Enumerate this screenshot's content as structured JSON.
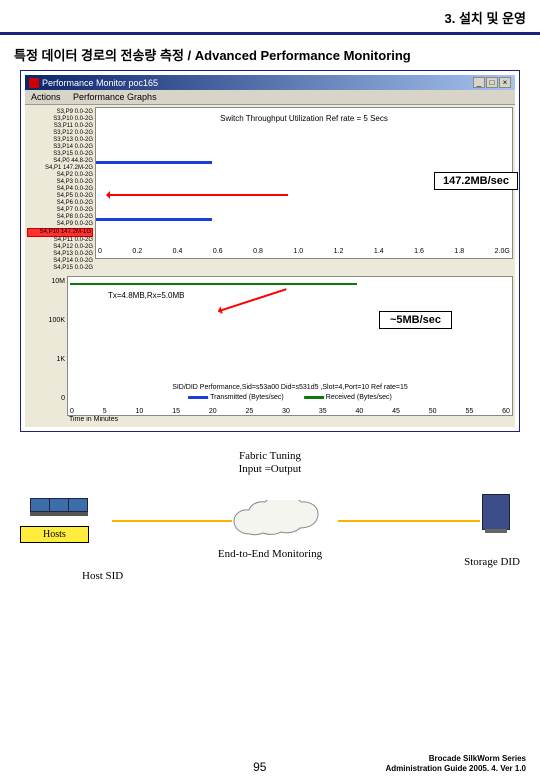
{
  "header": {
    "chapter": "3. 설치 및 운영"
  },
  "section_title": "특정 데이터 경로의 전송량 측정 / Advanced Performance Monitoring",
  "window": {
    "title": "Performance Monitor poc165",
    "menu": [
      "Actions",
      "Performance Graphs"
    ],
    "controls": [
      "_",
      "□",
      "×"
    ]
  },
  "chart_data": [
    {
      "type": "bar",
      "title": "Switch Throughput Utilization Ref rate = 5 Secs",
      "y_ports": [
        "S3,P9  0.0-2G",
        "S3,P10 0.0-2G",
        "S3,P11 0.0-2G",
        "S3,P12 0.0-2G",
        "S3,P13 0.0-2G",
        "S3,P14 0.0-2G",
        "S3,P15 0.0-2G",
        "S4,P0  44.8-2G",
        "S4,P1  147.2M-2G",
        "S4,P2  0.0-2G",
        "S4,P3  0.0-2G",
        "S4,P4  0.0-2G",
        "S4,P5  0.0-2G",
        "S4,P6  0.0-2G",
        "S4,P7  0.0-2G",
        "S4,P8  0.0-2G",
        "S4,P9  0.0-2G",
        "S4,P10 147.2M-1G",
        "S4,P11 0.0-2G",
        "S4,P12 0.0-2G",
        "S4,P13 0.0-2G",
        "S4,P14 0.0-2G",
        "S4,P15 0.0-2G"
      ],
      "highlight_port_index": 17,
      "blue_bars": [
        {
          "port_index": 8,
          "frac": 0.28
        },
        {
          "port_index": 17,
          "frac": 0.28
        }
      ],
      "x_ticks": [
        "0",
        "0.2",
        "0.4",
        "0.6",
        "0.8",
        "1.0",
        "1.2",
        "1.4",
        "1.6",
        "1.8",
        "2.0G"
      ],
      "callout": "147.2MB/sec"
    },
    {
      "type": "line",
      "title_below": "SID/DID Performance,Sid=s53a00  Did=s531d5 ,Slot=4,Port=10 Ref rate=15",
      "y_ticks": [
        "10M",
        "100K",
        "1K",
        "0"
      ],
      "x_ticks": [
        "0",
        "5",
        "10",
        "15",
        "20",
        "25",
        "30",
        "35",
        "40",
        "45",
        "50",
        "55",
        "60"
      ],
      "x_label": "Time in Minutes",
      "series": [
        {
          "name": "Transmitted (Bytes/sec)",
          "color": "#1a3de0"
        },
        {
          "name": "Received (Bytes/sec)",
          "color": "#0b7a0b"
        }
      ],
      "txrx_annotation": "Tx=4.8MB,Rx=5.0MB",
      "callout": "~5MB/sec"
    }
  ],
  "diagram": {
    "fabric_label_line1": "Fabric Tuning",
    "fabric_label_line2": "Input =Output",
    "hosts_label": "Hosts",
    "host_sid": "Host SID",
    "e2e": "End-to-End Monitoring",
    "storage_did": "Storage DID"
  },
  "footer": {
    "page": "95",
    "line1": "Brocade SilkWorm Series",
    "line2": "Administration Guide 2005. 4. Ver 1.0"
  }
}
